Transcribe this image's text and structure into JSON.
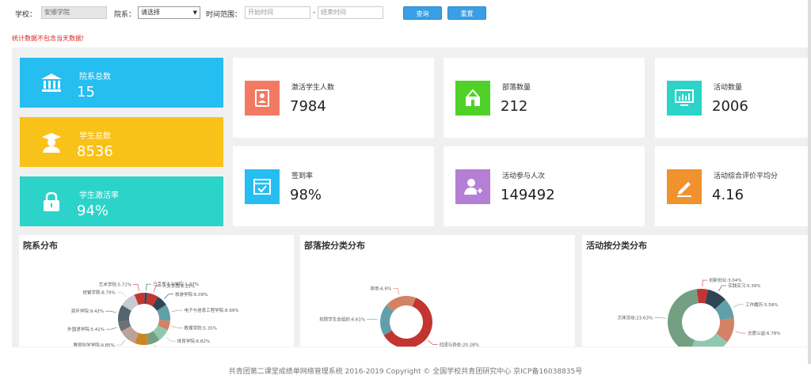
{
  "filters": {
    "school_label": "学校：",
    "school_value": "安顺学院",
    "dept_label": "院系：",
    "dept_value": "请选择",
    "time_label": "时间范围：",
    "start_placeholder": "开始时间",
    "dash": "-",
    "end_placeholder": "结束时间",
    "query_label": "查询",
    "reset_label": "重置"
  },
  "notice": "统计数据不包含当天数据!",
  "big_cards": [
    {
      "title": "院系总数",
      "value": "15",
      "color": "#26bdf0",
      "icon": "bank-icon"
    },
    {
      "title": "学生总数",
      "value": "8536",
      "color": "#f9c218",
      "icon": "graduate-icon"
    },
    {
      "title": "学生激活率",
      "value": "94%",
      "color": "#2cd3c8",
      "icon": "lock-icon"
    }
  ],
  "cards": [
    {
      "title": "激活学生人数",
      "value": "7984",
      "color": "#f27a63",
      "icon": "contact-book-icon"
    },
    {
      "title": "部落数量",
      "value": "212",
      "color": "#4fd129",
      "icon": "tribe-icon"
    },
    {
      "title": "活动数量",
      "value": "2006",
      "color": "#2cd3c8",
      "icon": "monitor-chart-icon"
    },
    {
      "title": "签到率",
      "value": "98%",
      "color": "#26bdf0",
      "icon": "calendar-check-icon"
    },
    {
      "title": "活动参与人次",
      "value": "149492",
      "color": "#b57fd6",
      "icon": "user-add-icon"
    },
    {
      "title": "活动综合评价平均分",
      "value": "4.16",
      "color": "#f0922e",
      "icon": "edit-icon"
    }
  ],
  "panels": [
    {
      "title": "院系分布"
    },
    {
      "title": "部落按分类分布"
    },
    {
      "title": "活动按分类分布"
    }
  ],
  "chart_data": [
    {
      "type": "pie",
      "title": "院系分布",
      "labels": [
        "人文学院",
        "旅游学院",
        "电子与信息工程学院",
        "数理学院",
        "体育学院",
        "特教学院",
        "化学化工学院",
        "教育科学学院",
        "外国语学院",
        "资环学院",
        "经管学院",
        "艺术学院",
        "马克思主义学院"
      ],
      "values": [
        6.25,
        6.09,
        8.99,
        5.35,
        6.82,
        6.77,
        7.32,
        9.85,
        5.41,
        9.42,
        8.79,
        5.72,
        1.37
      ],
      "label_texts": [
        "人文学院:6.25%",
        "旅游学院:6.09%",
        "电子与信息工程学院:8.99%",
        "数理学院:5.35%",
        "体育学院:6.82%",
        "特教学院:6.77%",
        "化学化工学院:7.32%",
        "教育科学学院:9.85%",
        "外国语学院:5.41%",
        "资环学院:9.42%",
        "经管学院:8.79%",
        "艺术学院:5.72%",
        "马克思主义学院:1.37%"
      ],
      "colors": [
        "#c23531",
        "#2f4554",
        "#61a0a8",
        "#d48265",
        "#91c7ae",
        "#749f83",
        "#ca8622",
        "#bda29a",
        "#6e7074",
        "#546570",
        "#c4ccd3",
        "#c23531",
        "#2f4554"
      ]
    },
    {
      "type": "pie",
      "title": "部落按分类分布",
      "labels": [
        "社团与协会",
        "校院学生会组织",
        "其他"
      ],
      "values": [
        20.28,
        6.61,
        6.6
      ],
      "label_texts": [
        "社团与协会:20.28%",
        "校院学生会组织:6.61%",
        "其他:6.6%"
      ],
      "colors": [
        "#c23531",
        "#61a0a8",
        "#d48265",
        "#2f4554"
      ]
    },
    {
      "type": "pie",
      "title": "活动按分类分布",
      "labels": [
        "创新创业",
        "实践实习",
        "工作履历",
        "志愿公益",
        "技能特长",
        "文体活动"
      ],
      "values": [
        3.04,
        5.39,
        5.58,
        6.78,
        11.12,
        23.63
      ],
      "label_texts": [
        "创新创业:3.04%",
        "实践实习:5.39%",
        "工作履历:5.58%",
        "志愿公益:6.78%",
        "技能特长:11.12%",
        "文体活动:23.63%"
      ],
      "colors": [
        "#c23531",
        "#2f4554",
        "#61a0a8",
        "#d48265",
        "#91c7ae",
        "#749f83",
        "#ca8622"
      ]
    }
  ],
  "footer": "共青团第二课堂成绩单网络管理系统     2016-2019 Copyright © 全国学校共青团研究中心  京ICP备16038835号"
}
